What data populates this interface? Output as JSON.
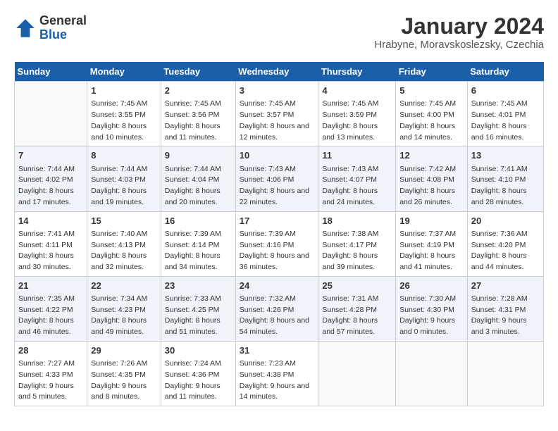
{
  "header": {
    "logo_line1": "General",
    "logo_line2": "Blue",
    "title": "January 2024",
    "subtitle": "Hrabyne, Moravskoslezsky, Czechia"
  },
  "days_of_week": [
    "Sunday",
    "Monday",
    "Tuesday",
    "Wednesday",
    "Thursday",
    "Friday",
    "Saturday"
  ],
  "weeks": [
    [
      {
        "day": "",
        "sunrise": "",
        "sunset": "",
        "daylight": ""
      },
      {
        "day": "1",
        "sunrise": "Sunrise: 7:45 AM",
        "sunset": "Sunset: 3:55 PM",
        "daylight": "Daylight: 8 hours and 10 minutes."
      },
      {
        "day": "2",
        "sunrise": "Sunrise: 7:45 AM",
        "sunset": "Sunset: 3:56 PM",
        "daylight": "Daylight: 8 hours and 11 minutes."
      },
      {
        "day": "3",
        "sunrise": "Sunrise: 7:45 AM",
        "sunset": "Sunset: 3:57 PM",
        "daylight": "Daylight: 8 hours and 12 minutes."
      },
      {
        "day": "4",
        "sunrise": "Sunrise: 7:45 AM",
        "sunset": "Sunset: 3:59 PM",
        "daylight": "Daylight: 8 hours and 13 minutes."
      },
      {
        "day": "5",
        "sunrise": "Sunrise: 7:45 AM",
        "sunset": "Sunset: 4:00 PM",
        "daylight": "Daylight: 8 hours and 14 minutes."
      },
      {
        "day": "6",
        "sunrise": "Sunrise: 7:45 AM",
        "sunset": "Sunset: 4:01 PM",
        "daylight": "Daylight: 8 hours and 16 minutes."
      }
    ],
    [
      {
        "day": "7",
        "sunrise": "Sunrise: 7:44 AM",
        "sunset": "Sunset: 4:02 PM",
        "daylight": "Daylight: 8 hours and 17 minutes."
      },
      {
        "day": "8",
        "sunrise": "Sunrise: 7:44 AM",
        "sunset": "Sunset: 4:03 PM",
        "daylight": "Daylight: 8 hours and 19 minutes."
      },
      {
        "day": "9",
        "sunrise": "Sunrise: 7:44 AM",
        "sunset": "Sunset: 4:04 PM",
        "daylight": "Daylight: 8 hours and 20 minutes."
      },
      {
        "day": "10",
        "sunrise": "Sunrise: 7:43 AM",
        "sunset": "Sunset: 4:06 PM",
        "daylight": "Daylight: 8 hours and 22 minutes."
      },
      {
        "day": "11",
        "sunrise": "Sunrise: 7:43 AM",
        "sunset": "Sunset: 4:07 PM",
        "daylight": "Daylight: 8 hours and 24 minutes."
      },
      {
        "day": "12",
        "sunrise": "Sunrise: 7:42 AM",
        "sunset": "Sunset: 4:08 PM",
        "daylight": "Daylight: 8 hours and 26 minutes."
      },
      {
        "day": "13",
        "sunrise": "Sunrise: 7:41 AM",
        "sunset": "Sunset: 4:10 PM",
        "daylight": "Daylight: 8 hours and 28 minutes."
      }
    ],
    [
      {
        "day": "14",
        "sunrise": "Sunrise: 7:41 AM",
        "sunset": "Sunset: 4:11 PM",
        "daylight": "Daylight: 8 hours and 30 minutes."
      },
      {
        "day": "15",
        "sunrise": "Sunrise: 7:40 AM",
        "sunset": "Sunset: 4:13 PM",
        "daylight": "Daylight: 8 hours and 32 minutes."
      },
      {
        "day": "16",
        "sunrise": "Sunrise: 7:39 AM",
        "sunset": "Sunset: 4:14 PM",
        "daylight": "Daylight: 8 hours and 34 minutes."
      },
      {
        "day": "17",
        "sunrise": "Sunrise: 7:39 AM",
        "sunset": "Sunset: 4:16 PM",
        "daylight": "Daylight: 8 hours and 36 minutes."
      },
      {
        "day": "18",
        "sunrise": "Sunrise: 7:38 AM",
        "sunset": "Sunset: 4:17 PM",
        "daylight": "Daylight: 8 hours and 39 minutes."
      },
      {
        "day": "19",
        "sunrise": "Sunrise: 7:37 AM",
        "sunset": "Sunset: 4:19 PM",
        "daylight": "Daylight: 8 hours and 41 minutes."
      },
      {
        "day": "20",
        "sunrise": "Sunrise: 7:36 AM",
        "sunset": "Sunset: 4:20 PM",
        "daylight": "Daylight: 8 hours and 44 minutes."
      }
    ],
    [
      {
        "day": "21",
        "sunrise": "Sunrise: 7:35 AM",
        "sunset": "Sunset: 4:22 PM",
        "daylight": "Daylight: 8 hours and 46 minutes."
      },
      {
        "day": "22",
        "sunrise": "Sunrise: 7:34 AM",
        "sunset": "Sunset: 4:23 PM",
        "daylight": "Daylight: 8 hours and 49 minutes."
      },
      {
        "day": "23",
        "sunrise": "Sunrise: 7:33 AM",
        "sunset": "Sunset: 4:25 PM",
        "daylight": "Daylight: 8 hours and 51 minutes."
      },
      {
        "day": "24",
        "sunrise": "Sunrise: 7:32 AM",
        "sunset": "Sunset: 4:26 PM",
        "daylight": "Daylight: 8 hours and 54 minutes."
      },
      {
        "day": "25",
        "sunrise": "Sunrise: 7:31 AM",
        "sunset": "Sunset: 4:28 PM",
        "daylight": "Daylight: 8 hours and 57 minutes."
      },
      {
        "day": "26",
        "sunrise": "Sunrise: 7:30 AM",
        "sunset": "Sunset: 4:30 PM",
        "daylight": "Daylight: 9 hours and 0 minutes."
      },
      {
        "day": "27",
        "sunrise": "Sunrise: 7:28 AM",
        "sunset": "Sunset: 4:31 PM",
        "daylight": "Daylight: 9 hours and 3 minutes."
      }
    ],
    [
      {
        "day": "28",
        "sunrise": "Sunrise: 7:27 AM",
        "sunset": "Sunset: 4:33 PM",
        "daylight": "Daylight: 9 hours and 5 minutes."
      },
      {
        "day": "29",
        "sunrise": "Sunrise: 7:26 AM",
        "sunset": "Sunset: 4:35 PM",
        "daylight": "Daylight: 9 hours and 8 minutes."
      },
      {
        "day": "30",
        "sunrise": "Sunrise: 7:24 AM",
        "sunset": "Sunset: 4:36 PM",
        "daylight": "Daylight: 9 hours and 11 minutes."
      },
      {
        "day": "31",
        "sunrise": "Sunrise: 7:23 AM",
        "sunset": "Sunset: 4:38 PM",
        "daylight": "Daylight: 9 hours and 14 minutes."
      },
      {
        "day": "",
        "sunrise": "",
        "sunset": "",
        "daylight": ""
      },
      {
        "day": "",
        "sunrise": "",
        "sunset": "",
        "daylight": ""
      },
      {
        "day": "",
        "sunrise": "",
        "sunset": "",
        "daylight": ""
      }
    ]
  ]
}
